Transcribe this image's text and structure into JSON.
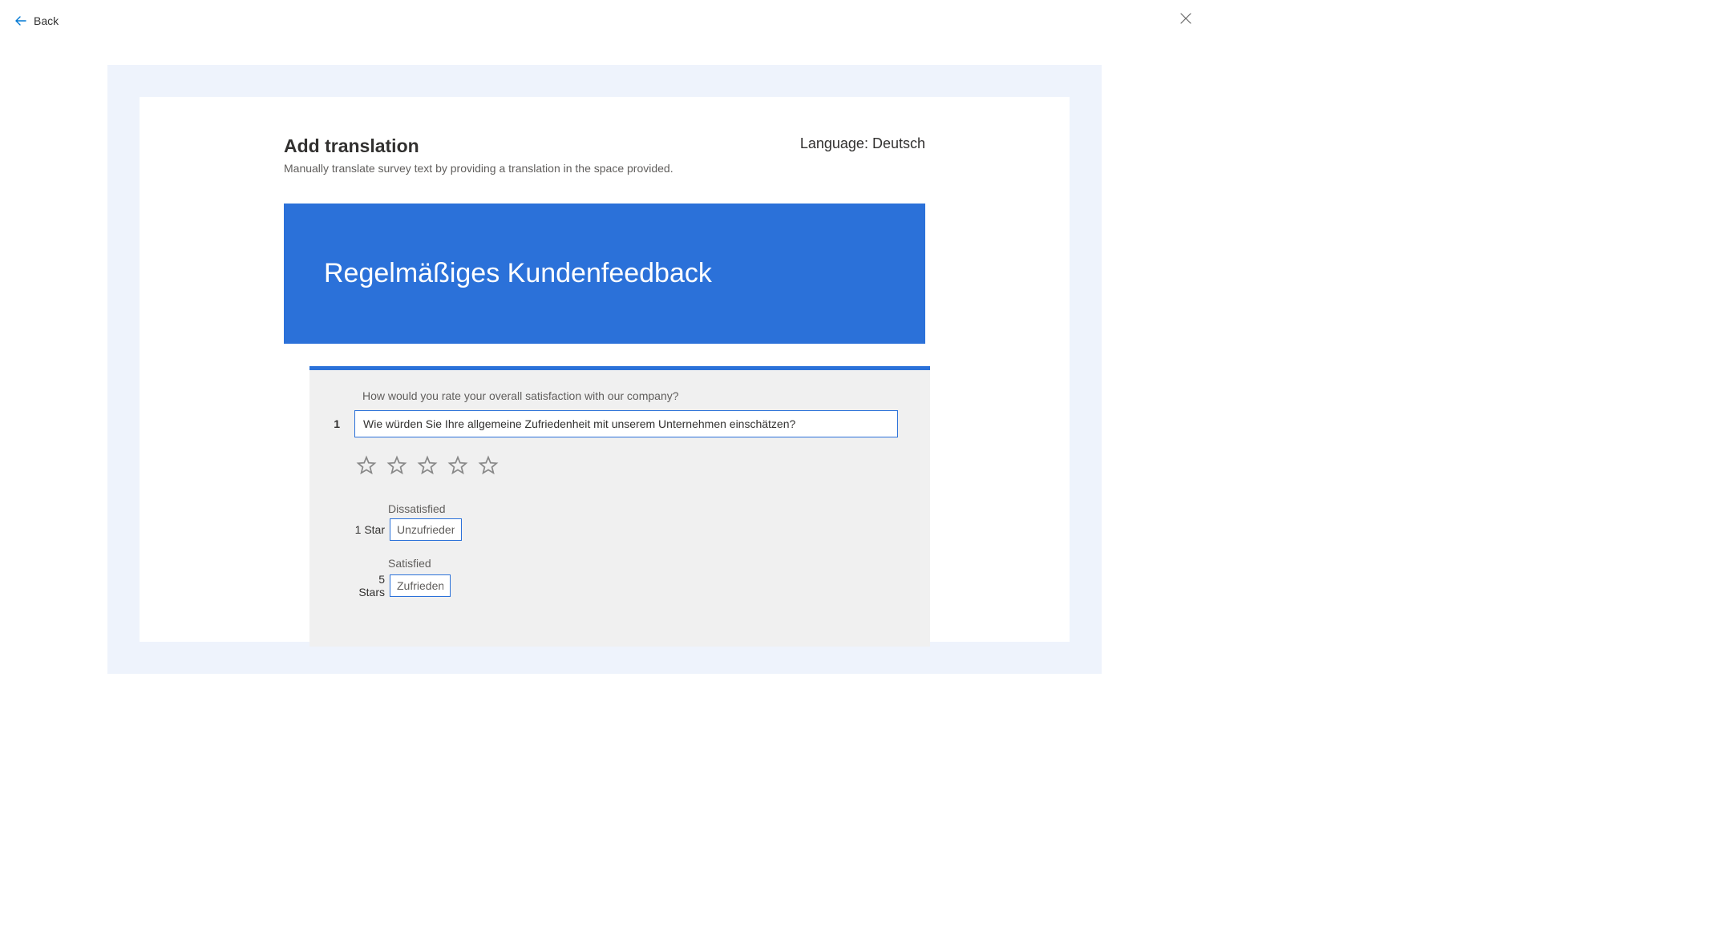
{
  "topbar": {
    "back_label": "Back"
  },
  "header": {
    "title": "Add translation",
    "subtitle": "Manually translate survey text by providing a translation in the space provided.",
    "language_prefix": "Language: ",
    "language_value": "Deutsch"
  },
  "survey": {
    "title_translation": "Regelmäßiges Kundenfeedback"
  },
  "question": {
    "number": "1",
    "source_text": "How would you rate your overall satisfaction with our company?",
    "translation_value": "Wie würden Sie Ihre allgemeine Zufriedenheit mit unserem Unternehmen einschätzen?",
    "ratings": [
      {
        "name": "1 Star",
        "source_label": "Dissatisfied",
        "translation_value": "Unzufrieden"
      },
      {
        "name": "5 Stars",
        "source_label": "Satisfied",
        "translation_value": "Zufrieden"
      }
    ]
  }
}
